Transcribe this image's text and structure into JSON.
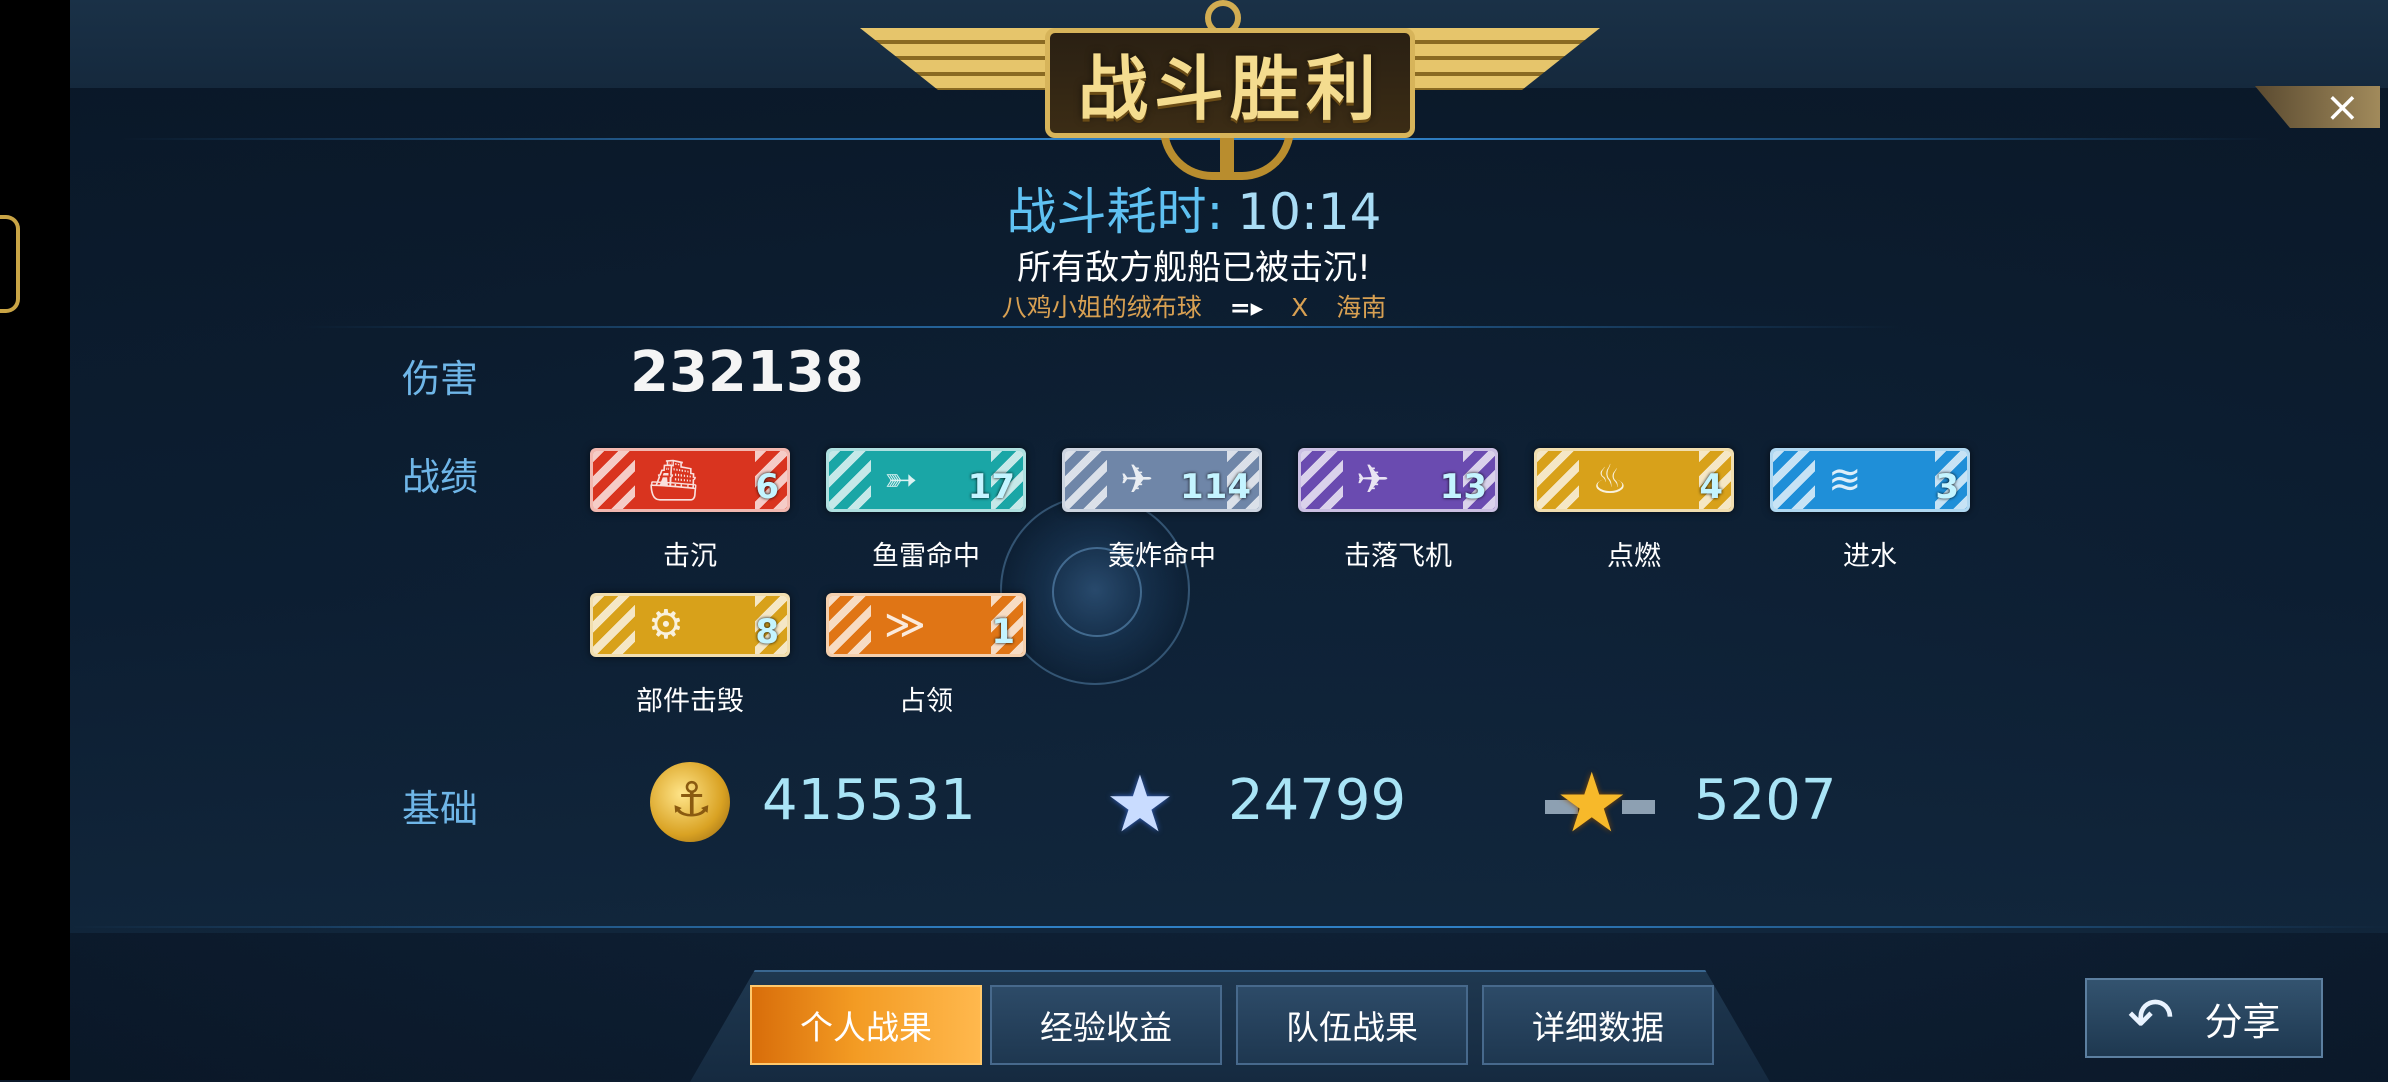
{
  "banner": {
    "title": "战斗胜利"
  },
  "close": {
    "icon": "close-icon",
    "label": "×"
  },
  "battle": {
    "time_label": "战斗耗时:",
    "time_value": "10:14",
    "result_message": "所有敌方舰船已被击沉!",
    "player_from": "八鸡小姐的绒布球",
    "arrow": "=▸",
    "marker": "X",
    "player_to": "海南"
  },
  "damage": {
    "label": "伤害",
    "value": "232138"
  },
  "record": {
    "label": "战绩",
    "badges": [
      {
        "label": "击沉",
        "count": "6",
        "color": "#d9341f",
        "icon": "ship-icon",
        "glyph": "⛴"
      },
      {
        "label": "鱼雷命中",
        "count": "17",
        "color": "#1aa6a6",
        "icon": "torpedo-icon",
        "glyph": "➳"
      },
      {
        "label": "轰炸命中",
        "count": "114",
        "color": "#6f86a8",
        "icon": "bomber-icon",
        "glyph": "✈"
      },
      {
        "label": "击落飞机",
        "count": "13",
        "color": "#6a4bb0",
        "icon": "plane-down-icon",
        "glyph": "✈"
      },
      {
        "label": "点燃",
        "count": "4",
        "color": "#d8a11a",
        "icon": "fire-icon",
        "glyph": "♨"
      },
      {
        "label": "进水",
        "count": "3",
        "color": "#1f8fd8",
        "icon": "water-icon",
        "glyph": "≋"
      },
      {
        "label": "部件击毁",
        "count": "8",
        "color": "#d8a11a",
        "icon": "gear-icon",
        "glyph": "⚙"
      },
      {
        "label": "占领",
        "count": "1",
        "color": "#e07515",
        "icon": "chevron-down-icon",
        "glyph": "≫"
      }
    ]
  },
  "base": {
    "label": "基础",
    "coins": {
      "icon": "coin-icon",
      "glyph": "⚓",
      "value": "415531"
    },
    "exp": {
      "icon": "star-icon",
      "glyph": "★",
      "value": "24799"
    },
    "rank": {
      "icon": "winged-star-icon",
      "glyph": "★",
      "value": "5207"
    }
  },
  "tabs": [
    {
      "label": "个人战果",
      "active": true
    },
    {
      "label": "经验收益",
      "active": false
    },
    {
      "label": "队伍战果",
      "active": false
    },
    {
      "label": "详细数据",
      "active": false
    }
  ],
  "share": {
    "label": "分享",
    "icon": "back-arrow-icon",
    "glyph": "↶"
  }
}
